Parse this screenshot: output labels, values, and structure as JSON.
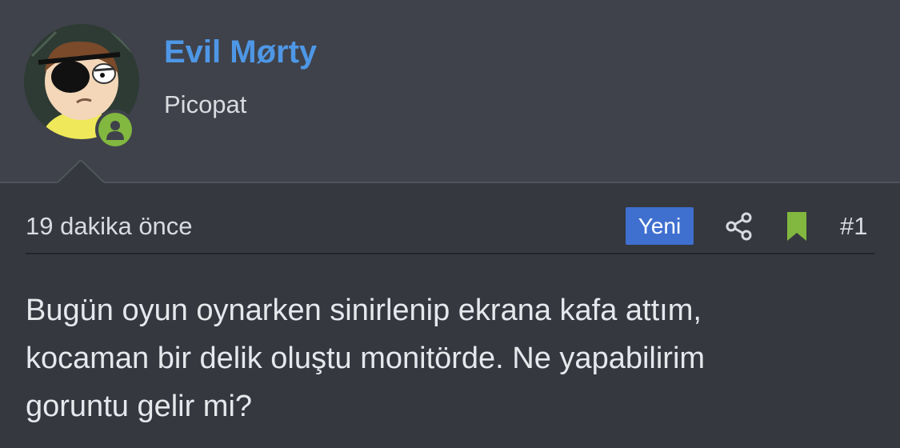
{
  "user": {
    "name": "Evil Mørty",
    "title": "Picopat",
    "online": true
  },
  "post": {
    "time_ago": "19 dakika önce",
    "badge": "Yeni",
    "number": "#1",
    "lines": [
      "Bugün oyun oynarken sinirlenip ekrana kafa attım,",
      "kocaman bir delik oluştu monitörde. Ne yapabilirim",
      "goruntu gelir mi?"
    ]
  },
  "icons": {
    "share": "share-icon",
    "bookmark": "bookmark-icon",
    "online_status": "user-status-icon"
  },
  "colors": {
    "username": "#4e97e6",
    "badge_bg": "#3f6fcf",
    "online": "#82b83f",
    "bookmark": "#82b83f",
    "header_bg": "#3f424b",
    "body_bg": "#35383f"
  }
}
